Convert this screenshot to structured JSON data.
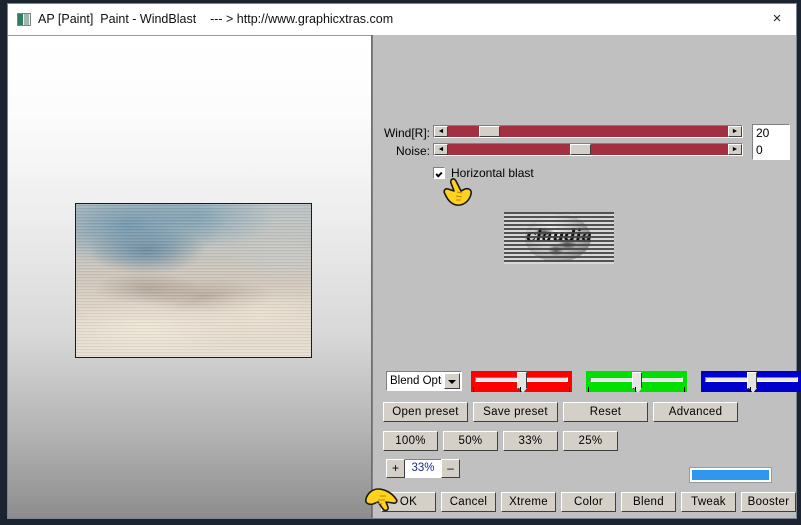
{
  "window": {
    "title": "AP [Paint]  Paint - WindBlast    --- > http://www.graphicxtras.com",
    "close_label": "×",
    "icon_name": "app-icon"
  },
  "colors": {
    "panel_bg": "#c0c0c0",
    "slider_track": "#a33041",
    "button_face": "#d4d0c8",
    "swatch": "#2f98ee",
    "zoom_text": "#1c2a8a",
    "red_slider": "#ff0000",
    "green_slider": "#00e000",
    "blue_slider": "#0000cc"
  },
  "controls": {
    "wind": {
      "label": "Wind[R]:",
      "value": "20",
      "thumb_percent": 12,
      "arrow_left": "◄",
      "arrow_right": "►"
    },
    "noise": {
      "label": "Noise:",
      "value": "0",
      "thumb_percent": 47,
      "arrow_left": "◄",
      "arrow_right": "►"
    },
    "horizontal_blast": {
      "label": "Horizontal blast",
      "checked": true
    }
  },
  "blend_combo": {
    "value": "Blend Opti",
    "arrow_name": "chevron-down-icon"
  },
  "rgb_sliders": [
    {
      "name": "red",
      "color": "#ff0000",
      "thumb_percent": 50
    },
    {
      "name": "green",
      "color": "#00e000",
      "thumb_percent": 50
    },
    {
      "name": "blue",
      "color": "#0000cc",
      "thumb_percent": 50
    }
  ],
  "preset_buttons": [
    {
      "label": "Open preset"
    },
    {
      "label": "Save preset"
    },
    {
      "label": "Reset"
    },
    {
      "label": "Advanced"
    }
  ],
  "zoom_buttons": [
    {
      "label": "100%"
    },
    {
      "label": "50%"
    },
    {
      "label": "33%"
    },
    {
      "label": "25%"
    }
  ],
  "zoom_stepper": {
    "plus": "+",
    "minus": "–",
    "value": "33%"
  },
  "action_buttons": [
    {
      "label": "OK"
    },
    {
      "label": "Cancel"
    },
    {
      "label": "Xtreme"
    },
    {
      "label": "Color"
    },
    {
      "label": "Blend"
    },
    {
      "label": "Tweak"
    },
    {
      "label": "Booster"
    }
  ],
  "thumbnail": {
    "word": "claudia",
    "description": "grayscale globe logo with horizontal blast stripes"
  },
  "main_preview": {
    "description": "wind-blasted blurred landscape, blue sky top-left, beige sand tones"
  },
  "cursors": [
    {
      "name": "hand-pointer-cursor-checkbox"
    },
    {
      "name": "hand-pointer-cursor-ok"
    }
  ]
}
